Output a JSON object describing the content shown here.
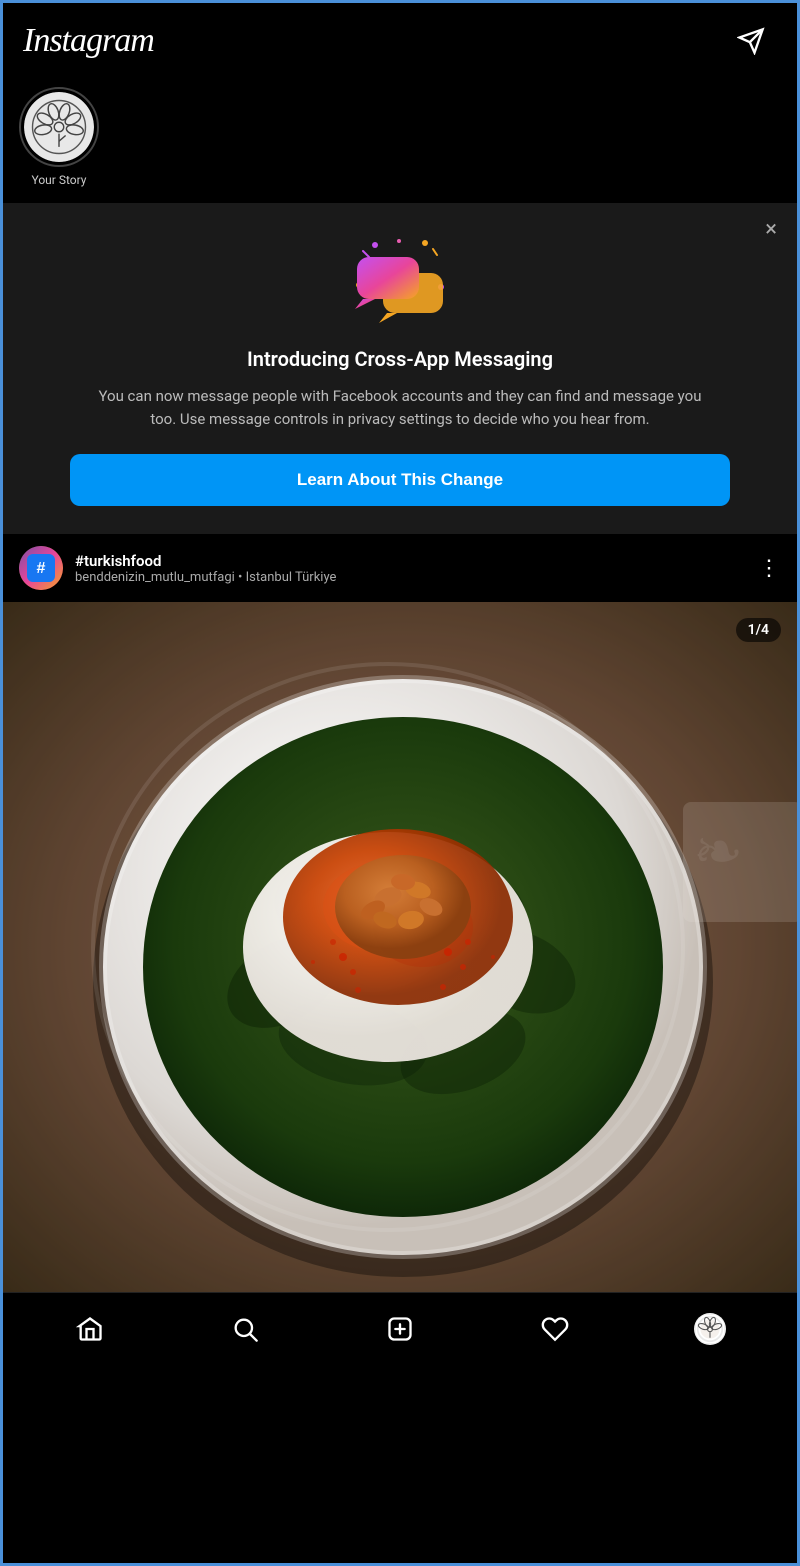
{
  "header": {
    "logo": "Instagram",
    "send_icon_label": "send"
  },
  "stories": [
    {
      "id": "your-story",
      "label": "Your Story",
      "has_story": false
    }
  ],
  "banner": {
    "title": "Introducing Cross-App Messaging",
    "body": "You can now message people with Facebook accounts and they can find and message you too. Use message controls in privacy settings to decide who you hear from.",
    "button_label": "Learn About This Change",
    "close_label": "×"
  },
  "post": {
    "username": "#turkishfood",
    "subtitle": "benddenizin_mutlu_mutfagi • Istanbul Türkiye",
    "image_counter": "1/4"
  },
  "bottom_nav": {
    "items": [
      "home",
      "search",
      "add",
      "heart",
      "profile"
    ]
  }
}
